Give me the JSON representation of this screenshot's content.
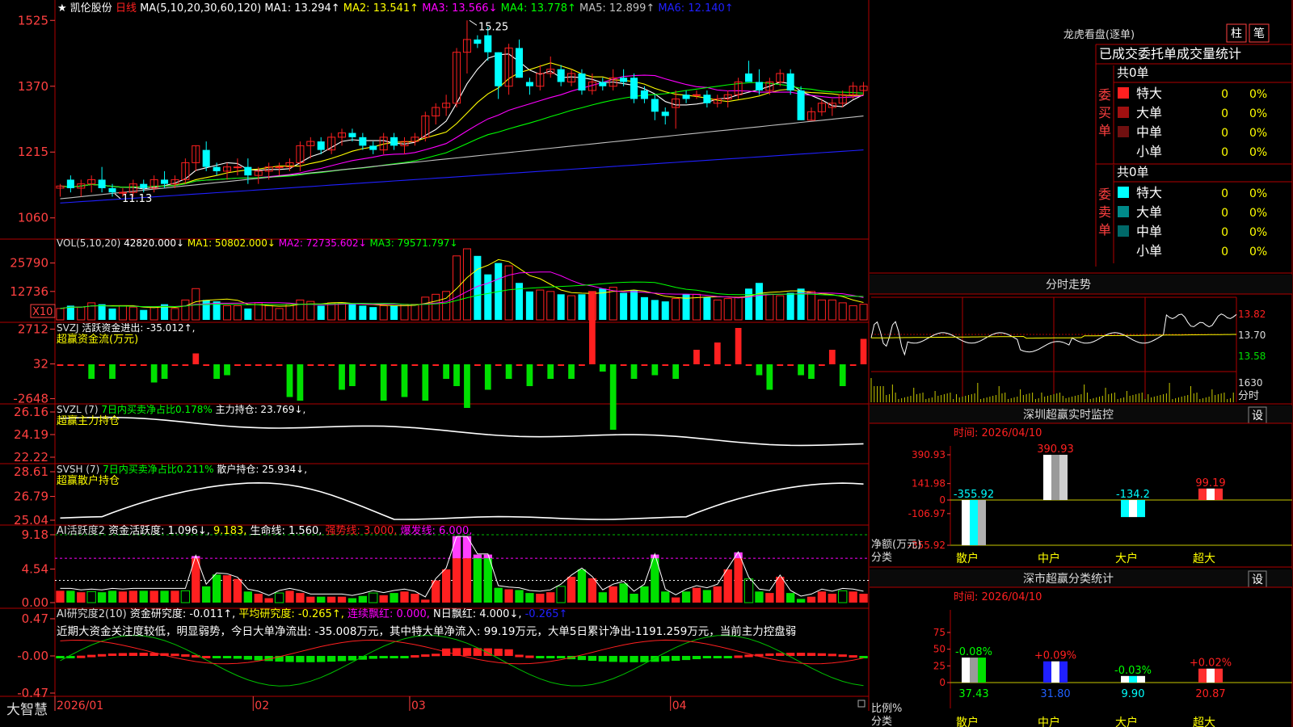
{
  "app": {
    "brand": "大智慧"
  },
  "stock": {
    "prefix": "★",
    "name": "凯伦股份",
    "period": "日线",
    "ma_label": "MA(5,10,20,30,60,120)",
    "ma": [
      {
        "label": "MA1: 13.294↑",
        "color": "#ffffff"
      },
      {
        "label": "MA2: 13.541↑",
        "color": "#ffff00"
      },
      {
        "label": "MA3: 13.566↓",
        "color": "#ff00ff"
      },
      {
        "label": "MA4: 13.778↑",
        "color": "#00ff00"
      },
      {
        "label": "MA5: 12.899↑",
        "color": "#c0c0c0"
      },
      {
        "label": "MA6: 12.140↑",
        "color": "#2020ff"
      }
    ]
  },
  "colors": {
    "up": "#ff2020",
    "down": "#00ffff",
    "grid": "#b00000",
    "axis": "#ff4040"
  },
  "chart_data": [
    {
      "id": "price",
      "type": "candlestick",
      "axis_ticks": [
        "1525",
        "1370",
        "1215",
        "1060"
      ],
      "annotations": [
        "15.25",
        "11.13"
      ],
      "ohlc": [
        [
          11.3,
          11.4,
          11.1,
          11.35
        ],
        [
          11.5,
          11.6,
          11.2,
          11.3
        ],
        [
          11.3,
          11.5,
          11.1,
          11.4
        ],
        [
          11.4,
          11.6,
          11.2,
          11.5
        ],
        [
          11.5,
          11.8,
          11.2,
          11.3
        ],
        [
          11.3,
          11.4,
          11.1,
          11.2
        ],
        [
          11.2,
          11.3,
          11.1,
          11.2
        ],
        [
          11.2,
          11.5,
          11.1,
          11.4
        ],
        [
          11.4,
          11.5,
          11.2,
          11.3
        ],
        [
          11.3,
          11.6,
          11.2,
          11.5
        ],
        [
          11.5,
          11.7,
          11.3,
          11.4
        ],
        [
          11.4,
          11.6,
          11.3,
          11.5
        ],
        [
          11.5,
          12.0,
          11.4,
          11.9
        ],
        [
          11.9,
          12.3,
          11.7,
          12.3
        ],
        [
          12.2,
          12.4,
          11.7,
          11.8
        ],
        [
          11.8,
          11.9,
          11.6,
          11.7
        ],
        [
          11.7,
          11.9,
          11.5,
          11.8
        ],
        [
          11.8,
          12.0,
          11.6,
          11.8
        ],
        [
          11.8,
          12.0,
          11.4,
          11.6
        ],
        [
          11.6,
          11.8,
          11.4,
          11.7
        ],
        [
          11.7,
          11.9,
          11.5,
          11.8
        ],
        [
          11.8,
          11.9,
          11.6,
          11.8
        ],
        [
          11.8,
          12.0,
          11.7,
          11.9
        ],
        [
          11.9,
          12.4,
          11.7,
          12.3
        ],
        [
          12.3,
          12.5,
          12.0,
          12.4
        ],
        [
          12.4,
          12.5,
          12.1,
          12.2
        ],
        [
          12.2,
          12.6,
          12.1,
          12.5
        ],
        [
          12.5,
          12.7,
          12.3,
          12.6
        ],
        [
          12.6,
          12.7,
          12.4,
          12.5
        ],
        [
          12.5,
          12.6,
          12.2,
          12.3
        ],
        [
          12.3,
          12.4,
          12.1,
          12.2
        ],
        [
          12.2,
          12.6,
          12.1,
          12.5
        ],
        [
          12.5,
          12.6,
          12.2,
          12.3
        ],
        [
          12.3,
          12.5,
          12.1,
          12.4
        ],
        [
          12.4,
          12.6,
          12.3,
          12.5
        ],
        [
          12.5,
          13.1,
          12.4,
          13.0
        ],
        [
          13.0,
          13.3,
          12.8,
          13.2
        ],
        [
          13.2,
          13.5,
          13.0,
          13.3
        ],
        [
          13.3,
          14.6,
          13.2,
          14.5
        ],
        [
          14.5,
          15.25,
          14.0,
          14.8
        ],
        [
          14.8,
          14.9,
          14.6,
          14.7
        ],
        [
          14.9,
          15.1,
          14.3,
          14.5
        ],
        [
          14.5,
          14.5,
          13.4,
          13.7
        ],
        [
          13.7,
          14.7,
          13.5,
          14.6
        ],
        [
          14.6,
          14.8,
          13.9,
          13.9
        ],
        [
          13.8,
          13.9,
          13.5,
          13.7
        ],
        [
          13.7,
          14.2,
          13.6,
          14.0
        ],
        [
          14.0,
          14.4,
          13.9,
          14.1
        ],
        [
          14.1,
          14.2,
          13.7,
          13.8
        ],
        [
          13.8,
          14.1,
          13.7,
          14.0
        ],
        [
          14.0,
          14.1,
          13.5,
          13.6
        ],
        [
          13.6,
          14.0,
          13.5,
          13.8
        ],
        [
          13.8,
          13.9,
          13.6,
          13.7
        ],
        [
          13.7,
          14.1,
          13.6,
          13.9
        ],
        [
          13.9,
          14.1,
          13.7,
          13.8
        ],
        [
          13.9,
          14.0,
          13.3,
          13.4
        ],
        [
          13.6,
          13.7,
          13.3,
          13.4
        ],
        [
          13.4,
          13.5,
          12.9,
          13.1
        ],
        [
          13.1,
          13.2,
          12.8,
          13.0
        ],
        [
          13.2,
          13.6,
          12.7,
          13.4
        ],
        [
          13.5,
          13.6,
          13.3,
          13.4
        ],
        [
          13.5,
          13.6,
          13.4,
          13.5
        ],
        [
          13.5,
          13.6,
          13.2,
          13.3
        ],
        [
          13.3,
          13.5,
          13.2,
          13.4
        ],
        [
          13.4,
          13.6,
          13.2,
          13.5
        ],
        [
          13.5,
          13.9,
          13.4,
          13.8
        ],
        [
          14.0,
          14.3,
          13.8,
          13.8
        ],
        [
          13.8,
          14.1,
          13.5,
          13.6
        ],
        [
          13.6,
          13.9,
          13.5,
          13.8
        ],
        [
          13.8,
          14.1,
          13.7,
          14.0
        ],
        [
          14.0,
          14.1,
          13.5,
          13.6
        ],
        [
          13.6,
          13.7,
          12.9,
          12.9
        ],
        [
          12.9,
          13.2,
          12.9,
          13.1
        ],
        [
          13.1,
          13.4,
          13.0,
          13.3
        ],
        [
          13.2,
          13.4,
          13.0,
          13.3
        ],
        [
          13.3,
          13.6,
          13.2,
          13.5
        ],
        [
          13.5,
          13.8,
          13.4,
          13.7
        ],
        [
          13.6,
          13.8,
          13.5,
          13.7
        ]
      ]
    },
    {
      "id": "volume",
      "type": "bar",
      "axis_ticks": [
        "25790",
        "12736",
        "X10"
      ],
      "title": "VOL(5,10,20)",
      "labels": [
        {
          "text": "42820.000↓",
          "color": "#ffffff"
        },
        {
          "text": "MA1: 50802.000↓",
          "color": "#ffff00"
        },
        {
          "text": "MA2: 72735.602↓",
          "color": "#ff00ff"
        },
        {
          "text": "MA3: 79571.797↓",
          "color": "#00ff00"
        }
      ]
    },
    {
      "id": "svzj",
      "type": "bar",
      "axis_ticks": [
        "2712",
        "32",
        "-2648"
      ],
      "title": "SVZJ",
      "labels": [
        {
          "text": "活跃资金进出: -35.012↑,",
          "color": "#ffffff"
        }
      ],
      "subtitle": "超赢资金流(万元)"
    },
    {
      "id": "svzl",
      "type": "line",
      "axis_ticks": [
        "26.16",
        "24.19",
        "22.22"
      ],
      "title": "SVZL (7)",
      "labels": [
        {
          "text": "7日内买卖净占比0.178%",
          "color": "#00ff00"
        },
        {
          "text": "主力持仓: 23.769↓,",
          "color": "#ffffff"
        }
      ],
      "subtitle": "超赢主力持仓"
    },
    {
      "id": "svsh",
      "type": "line",
      "axis_ticks": [
        "28.61",
        "26.79",
        "25.04"
      ],
      "title": "SVSH (7)",
      "labels": [
        {
          "text": "7日内买卖净占比0.211%",
          "color": "#00ff00"
        },
        {
          "text": "散户持仓: 25.934↓,",
          "color": "#ffffff"
        }
      ],
      "subtitle": "超赢散户持仓"
    },
    {
      "id": "ai1",
      "type": "bar",
      "axis_ticks": [
        "9.18",
        "4.54",
        "0.00"
      ],
      "title": "AI活跃度2",
      "labels": [
        {
          "text": "资金活跃度: 1.096↓,",
          "color": "#ffffff"
        },
        {
          "text": "9.183,",
          "color": "#ffff00"
        },
        {
          "text": "生命线: 1.560,",
          "color": "#ffffff"
        },
        {
          "text": "强势线: 3.000,",
          "color": "#ff2020"
        },
        {
          "text": "爆发线: 6.000,",
          "color": "#ff00ff"
        }
      ]
    },
    {
      "id": "ai2",
      "type": "bar",
      "axis_ticks": [
        "0.47",
        "-0.00",
        "-0.47"
      ],
      "title": "AI研究度2(10)",
      "labels": [
        {
          "text": "资金研究度: -0.011↑,",
          "color": "#ffffff"
        },
        {
          "text": "平均研究度: -0.265↑,",
          "color": "#ffff00"
        },
        {
          "text": "连续飘红: 0.000,",
          "color": "#ff00ff"
        },
        {
          "text": "N日飘红: 4.000↓,",
          "color": "#ffffff"
        },
        {
          "text": "-0.265↑",
          "color": "#2020ff"
        }
      ],
      "note": "近期大资金关注度较低，明显弱势，今日大单净流出: -35.008万元，其中特大单净流入: 99.19万元，大单5日累计净出-1191.259万元，当前主力控盘弱"
    },
    {
      "id": "szmon",
      "type": "bar",
      "title": "深圳超赢实时监控",
      "date": "时间: 2026/04/10",
      "axis_ticks": [
        "390.93",
        "141.98",
        "0",
        "-106.97",
        "-355.92"
      ],
      "y_label": "净额(万元)",
      "x_label": "分类",
      "categories": [
        "散户",
        "中户",
        "大户",
        "超大"
      ],
      "values": [
        -355.92,
        390.93,
        -134.2,
        99.19
      ]
    },
    {
      "id": "szcls",
      "type": "bar",
      "title": "深市超赢分类统计",
      "date": "时间: 2026/04/10",
      "axis_ticks": [
        "75",
        "50",
        "25",
        "0"
      ],
      "y_label": "比例%",
      "x_label": "分类",
      "categories": [
        "散户",
        "中户",
        "大户",
        "超大"
      ],
      "values": [
        37.43,
        31.8,
        9.9,
        20.87
      ],
      "changes": [
        "-0.08%",
        "+0.09%",
        "-0.03%",
        "+0.02%"
      ]
    },
    {
      "id": "intraday",
      "type": "line",
      "title": "分时走势",
      "axis_ticks": [
        "13.82",
        "13.70",
        "13.58"
      ],
      "vol_tick": "1630",
      "vol_unit": "分时"
    }
  ],
  "xaxis": {
    "months": [
      "2026/01",
      "02",
      "03",
      "04"
    ]
  },
  "dragon": {
    "title": "龙虎看盘(逐单)",
    "btn1": "柱",
    "btn2": "笔",
    "tab": "已成交委托单成交量统计",
    "buy": {
      "label": "委买单",
      "total": "共0单",
      "rows": [
        {
          "name": "特大",
          "n": "0",
          "p": "0%",
          "color": "#ff2020"
        },
        {
          "name": "大单",
          "n": "0",
          "p": "0%",
          "color": "#a01010"
        },
        {
          "name": "中单",
          "n": "0",
          "p": "0%",
          "color": "#701010"
        },
        {
          "name": "小单",
          "n": "0",
          "p": "0%",
          "color": ""
        }
      ]
    },
    "sell": {
      "label": "委卖单",
      "total": "共0单",
      "rows": [
        {
          "name": "特大",
          "n": "0",
          "p": "0%",
          "color": "#00ffff"
        },
        {
          "name": "大单",
          "n": "0",
          "p": "0%",
          "color": "#008a8a"
        },
        {
          "name": "中单",
          "n": "0",
          "p": "0%",
          "color": "#006868"
        },
        {
          "name": "小单",
          "n": "0",
          "p": "0%",
          "color": ""
        }
      ]
    }
  },
  "settings_label": "设"
}
